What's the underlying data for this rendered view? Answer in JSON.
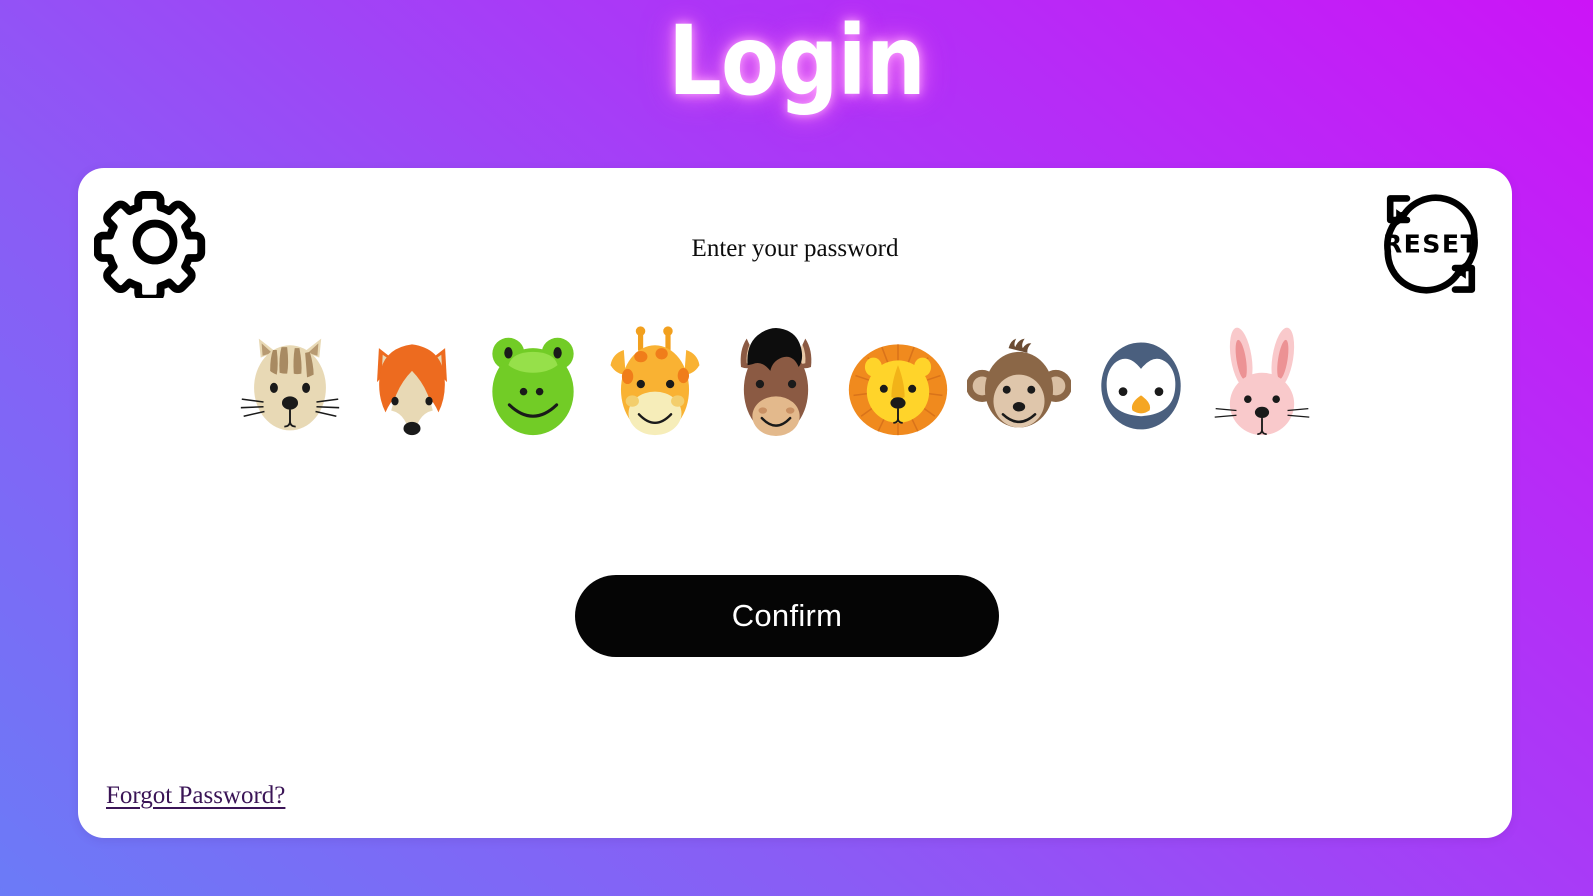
{
  "page": {
    "title": "Login",
    "background_gradient_from": "#6b7bf7",
    "background_gradient_to": "#cc14f7",
    "title_color": "#ffffff",
    "title_glow_color": "#ff8af0"
  },
  "card": {
    "background": "#ffffff",
    "prompt": "Enter your password"
  },
  "settings_button": {
    "name": "settings",
    "icon": "gear-icon",
    "color": "#000000"
  },
  "reset_button": {
    "label": "RESET",
    "icon": "reset-circular-arrows-icon",
    "color": "#000000"
  },
  "password_options": [
    {
      "id": "cat",
      "label": "Cat",
      "icon": "cat-face-icon",
      "color": "#e8d9b5"
    },
    {
      "id": "fox",
      "label": "Fox",
      "icon": "fox-face-icon",
      "color": "#ed6b1f"
    },
    {
      "id": "frog",
      "label": "Frog",
      "icon": "frog-face-icon",
      "color": "#72cc26"
    },
    {
      "id": "giraffe",
      "label": "Giraffe",
      "icon": "giraffe-face-icon",
      "color": "#f9b233"
    },
    {
      "id": "horse",
      "label": "Horse",
      "icon": "horse-face-icon",
      "color": "#8b5a43"
    },
    {
      "id": "lion",
      "label": "Lion",
      "icon": "lion-face-icon",
      "color": "#ffd42a"
    },
    {
      "id": "monkey",
      "label": "Monkey",
      "icon": "monkey-face-icon",
      "color": "#8b6747"
    },
    {
      "id": "penguin",
      "label": "Penguin",
      "icon": "penguin-face-icon",
      "color": "#4a5f7e"
    },
    {
      "id": "rabbit",
      "label": "Rabbit",
      "icon": "rabbit-face-icon",
      "color": "#f9c9cb"
    }
  ],
  "confirm_button": {
    "label": "Confirm",
    "background": "#050505",
    "text_color": "#ffffff"
  },
  "forgot_link": {
    "label": "Forgot Password?",
    "color": "#3a1456"
  }
}
